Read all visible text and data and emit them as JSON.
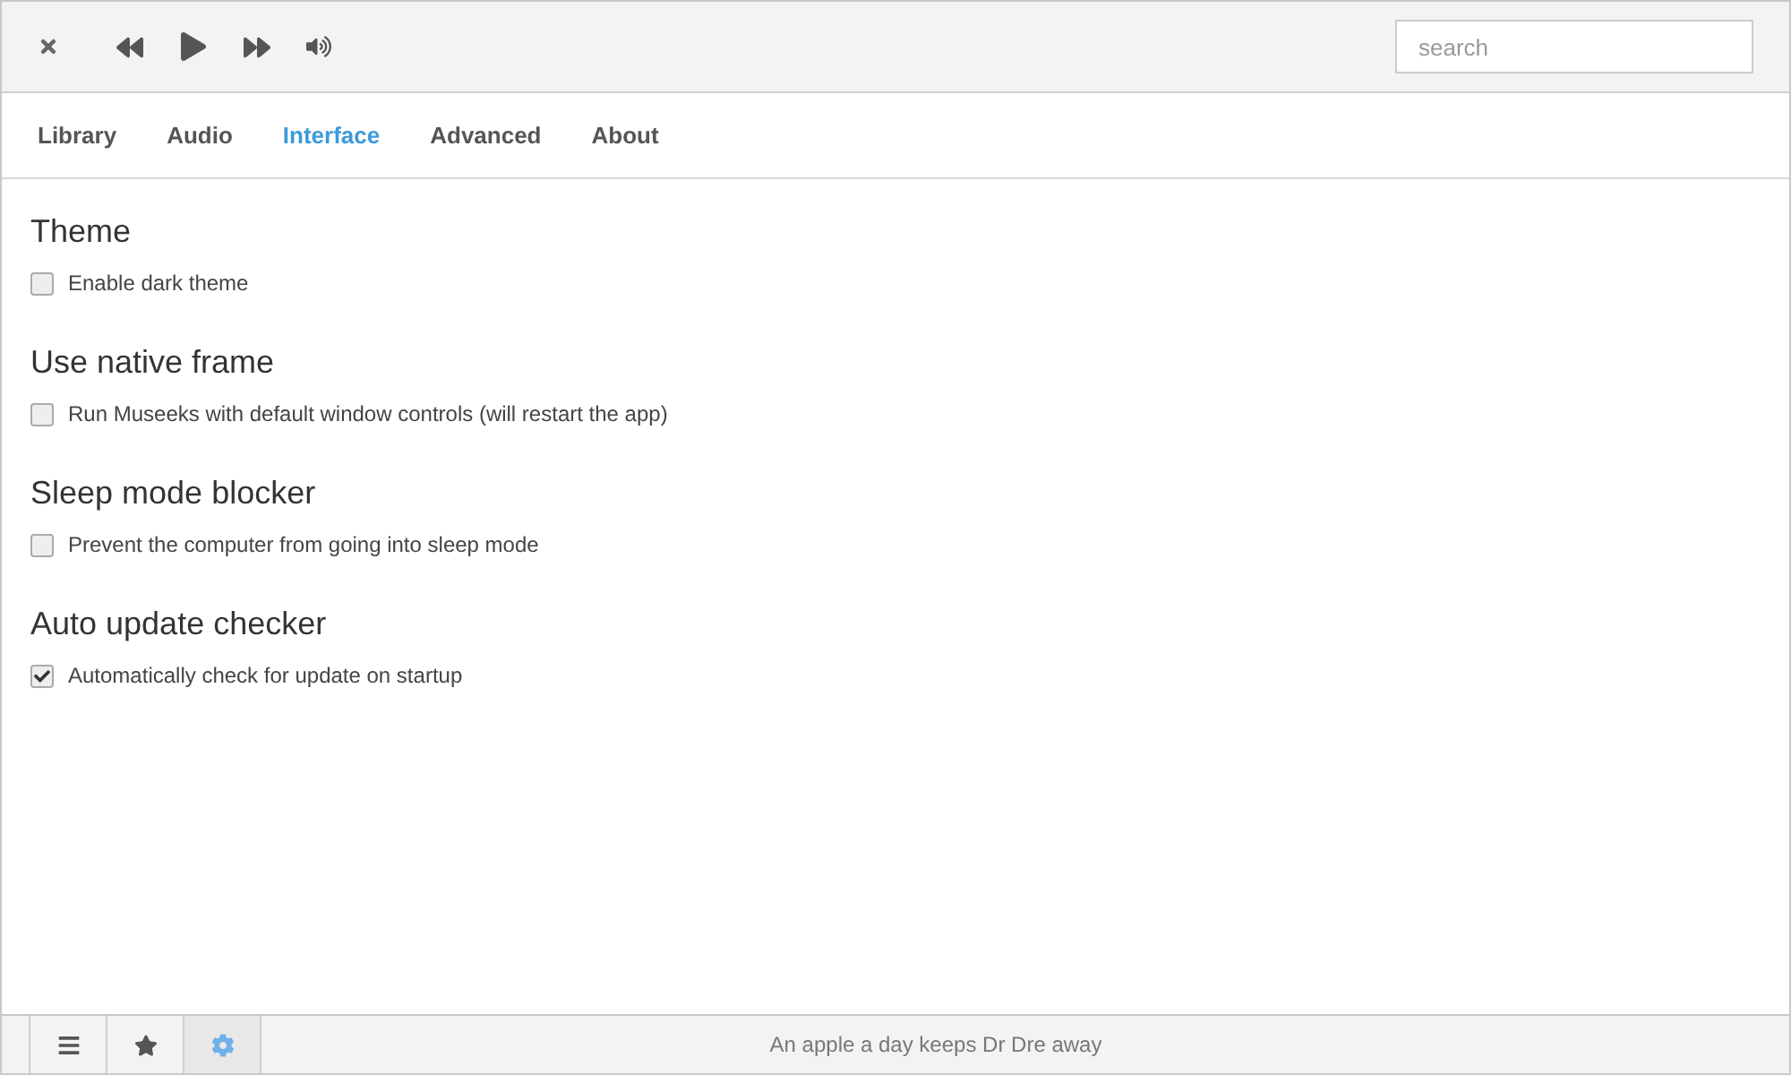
{
  "search": {
    "placeholder": "search"
  },
  "tabs": [
    {
      "label": "Library",
      "selected": false
    },
    {
      "label": "Audio",
      "selected": false
    },
    {
      "label": "Interface",
      "selected": true
    },
    {
      "label": "Advanced",
      "selected": false
    },
    {
      "label": "About",
      "selected": false
    }
  ],
  "sections": [
    {
      "title": "Theme",
      "option": {
        "label": "Enable dark theme",
        "checked": false
      }
    },
    {
      "title": "Use native frame",
      "option": {
        "label": "Run Museeks with default window controls (will restart the app)",
        "checked": false
      }
    },
    {
      "title": "Sleep mode blocker",
      "option": {
        "label": "Prevent the computer from going into sleep mode",
        "checked": false
      }
    },
    {
      "title": "Auto update checker",
      "option": {
        "label": "Automatically check for update on startup",
        "checked": true
      }
    }
  ],
  "footer_nav": [
    {
      "kind": "list",
      "selected": false
    },
    {
      "kind": "star",
      "selected": false
    },
    {
      "kind": "gear",
      "selected": true
    }
  ],
  "status_text": "An apple a day keeps Dr Dre away"
}
